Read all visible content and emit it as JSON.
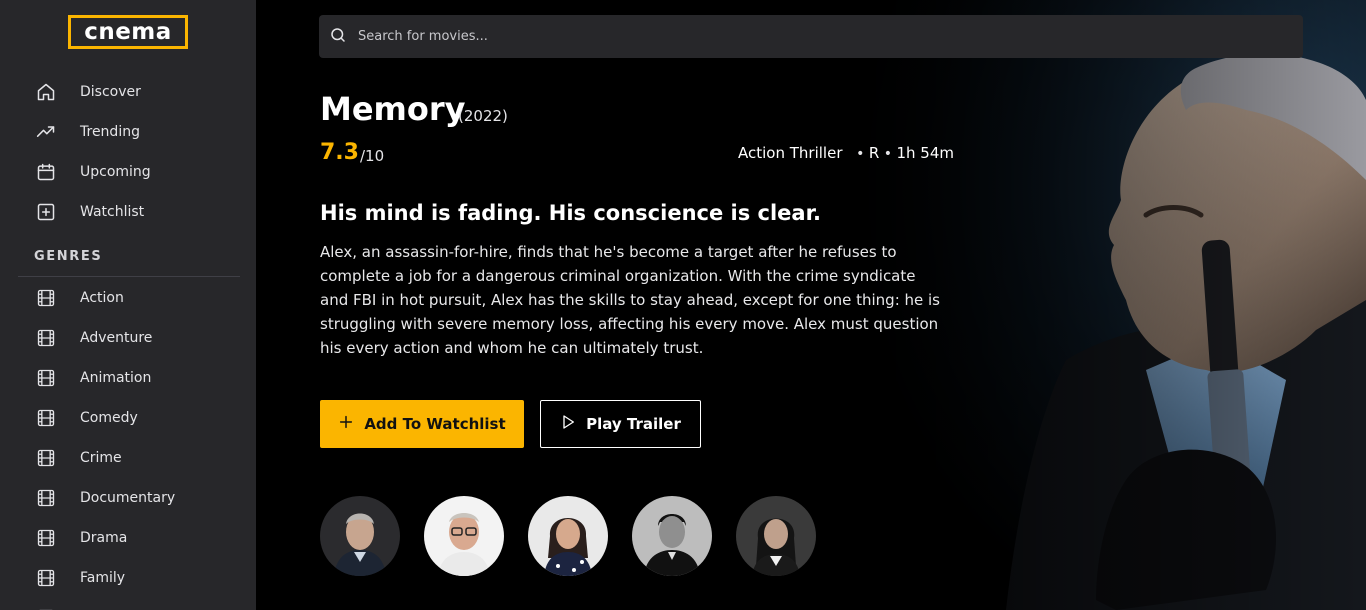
{
  "app": {
    "logo_text": "cnema",
    "accent": "#fbb500"
  },
  "sidebar": {
    "nav": [
      {
        "label": "Discover",
        "icon": "home-icon"
      },
      {
        "label": "Trending",
        "icon": "trending-icon"
      },
      {
        "label": "Upcoming",
        "icon": "calendar-icon"
      },
      {
        "label": "Watchlist",
        "icon": "plus-square-icon"
      }
    ],
    "genres_heading": "GENRES",
    "genres": [
      {
        "label": "Action",
        "icon": "film-icon"
      },
      {
        "label": "Adventure",
        "icon": "film-icon"
      },
      {
        "label": "Animation",
        "icon": "film-icon"
      },
      {
        "label": "Comedy",
        "icon": "film-icon"
      },
      {
        "label": "Crime",
        "icon": "film-icon"
      },
      {
        "label": "Documentary",
        "icon": "film-icon"
      },
      {
        "label": "Drama",
        "icon": "film-icon"
      },
      {
        "label": "Family",
        "icon": "film-icon"
      }
    ]
  },
  "search": {
    "placeholder": "Search for movies..."
  },
  "movie": {
    "title": "Memory",
    "year": "(2022)",
    "rating": "7.3",
    "rating_max": "/10",
    "genres": "Action Thriller",
    "certification": "R",
    "runtime": "1h 54m",
    "tagline": "His mind is fading. His conscience is clear.",
    "overview": "Alex, an assassin-for-hire, finds that he's become a target after he refuses to complete a job for a dangerous criminal organization. With the crime syndicate and FBI in hot pursuit, Alex has the skills to stay ahead, except for one thing: he is struggling with severe memory loss, affecting his every move. Alex must question his every action and whom he can ultimately trust."
  },
  "actions": {
    "watchlist_label": "Add To Watchlist",
    "trailer_label": "Play Trailer"
  },
  "cast": [
    {
      "icon": "cast-photo-1"
    },
    {
      "icon": "cast-photo-2"
    },
    {
      "icon": "cast-photo-3"
    },
    {
      "icon": "cast-photo-4"
    },
    {
      "icon": "cast-photo-5"
    }
  ]
}
